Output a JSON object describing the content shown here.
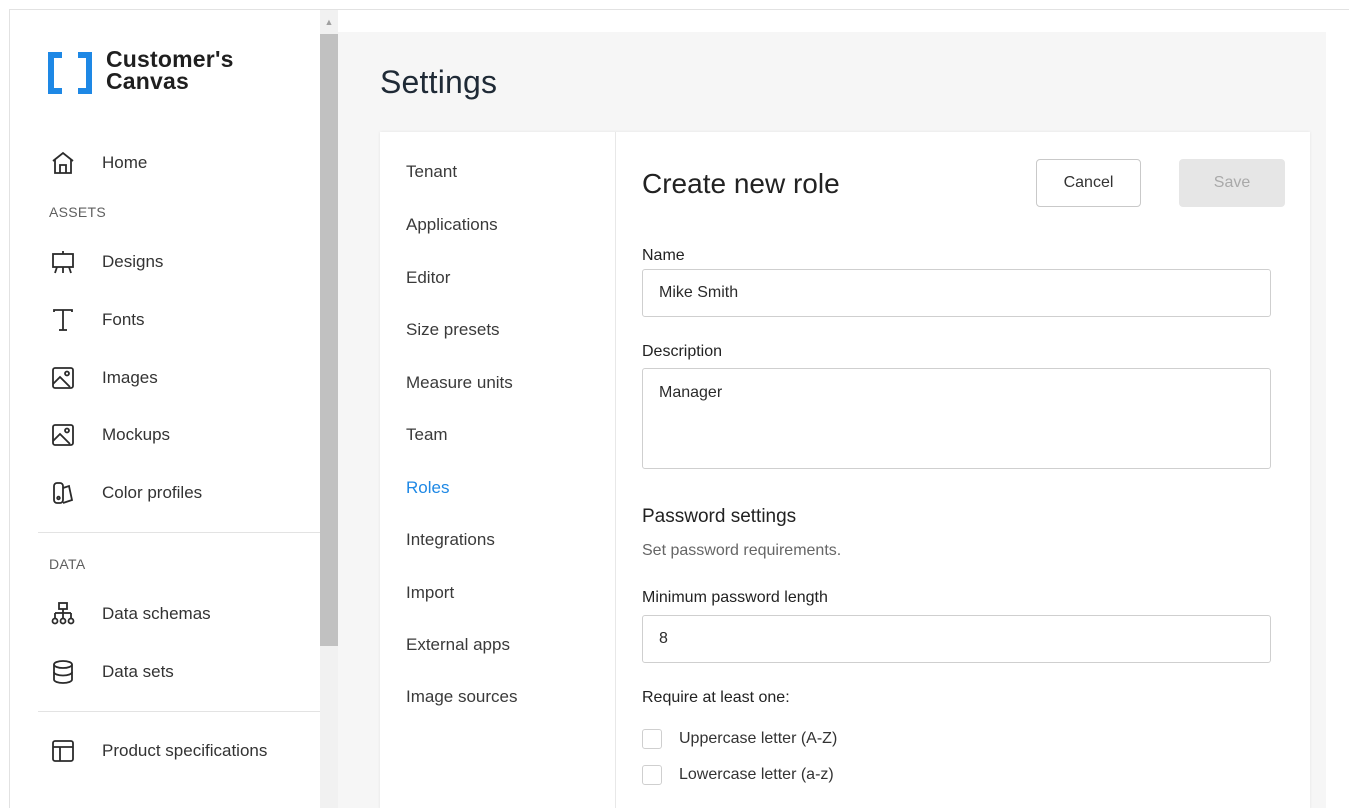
{
  "app": {
    "logo_line1": "Customer's",
    "logo_line2": "Canvas"
  },
  "sidebar": {
    "home": {
      "label": "Home",
      "icon": "home-icon"
    },
    "assets_section": "ASSETS",
    "assets": [
      {
        "label": "Designs",
        "icon": "easel-icon"
      },
      {
        "label": "Fonts",
        "icon": "font-icon"
      },
      {
        "label": "Images",
        "icon": "image-icon"
      },
      {
        "label": "Mockups",
        "icon": "image-icon"
      },
      {
        "label": "Color profiles",
        "icon": "swatch-icon"
      }
    ],
    "data_section": "DATA",
    "data": [
      {
        "label": "Data schemas",
        "icon": "hierarchy-icon"
      },
      {
        "label": "Data sets",
        "icon": "database-icon"
      }
    ],
    "bottom": [
      {
        "label": "Product specifications",
        "icon": "layout-icon"
      }
    ]
  },
  "page": {
    "title": "Settings"
  },
  "settings_nav": {
    "active": "Roles",
    "items": [
      "Tenant",
      "Applications",
      "Editor",
      "Size presets",
      "Measure units",
      "Team",
      "Roles",
      "Integrations",
      "Import",
      "External apps",
      "Image sources"
    ]
  },
  "form": {
    "title": "Create new role",
    "cancel_label": "Cancel",
    "save_label": "Save",
    "name_label": "Name",
    "name_value": "Mike Smith",
    "description_label": "Description",
    "description_value": "Manager",
    "password_title": "Password settings",
    "password_desc": "Set password requirements.",
    "min_length_label": "Minimum password length",
    "min_length_value": "8",
    "require_label": "Require at least one:",
    "checkboxes": [
      {
        "label": "Uppercase letter (A-Z)",
        "checked": false
      },
      {
        "label": "Lowercase letter (a-z)",
        "checked": false
      }
    ]
  },
  "colors": {
    "accent": "#1e88e5",
    "background": "#f6f6f6"
  }
}
